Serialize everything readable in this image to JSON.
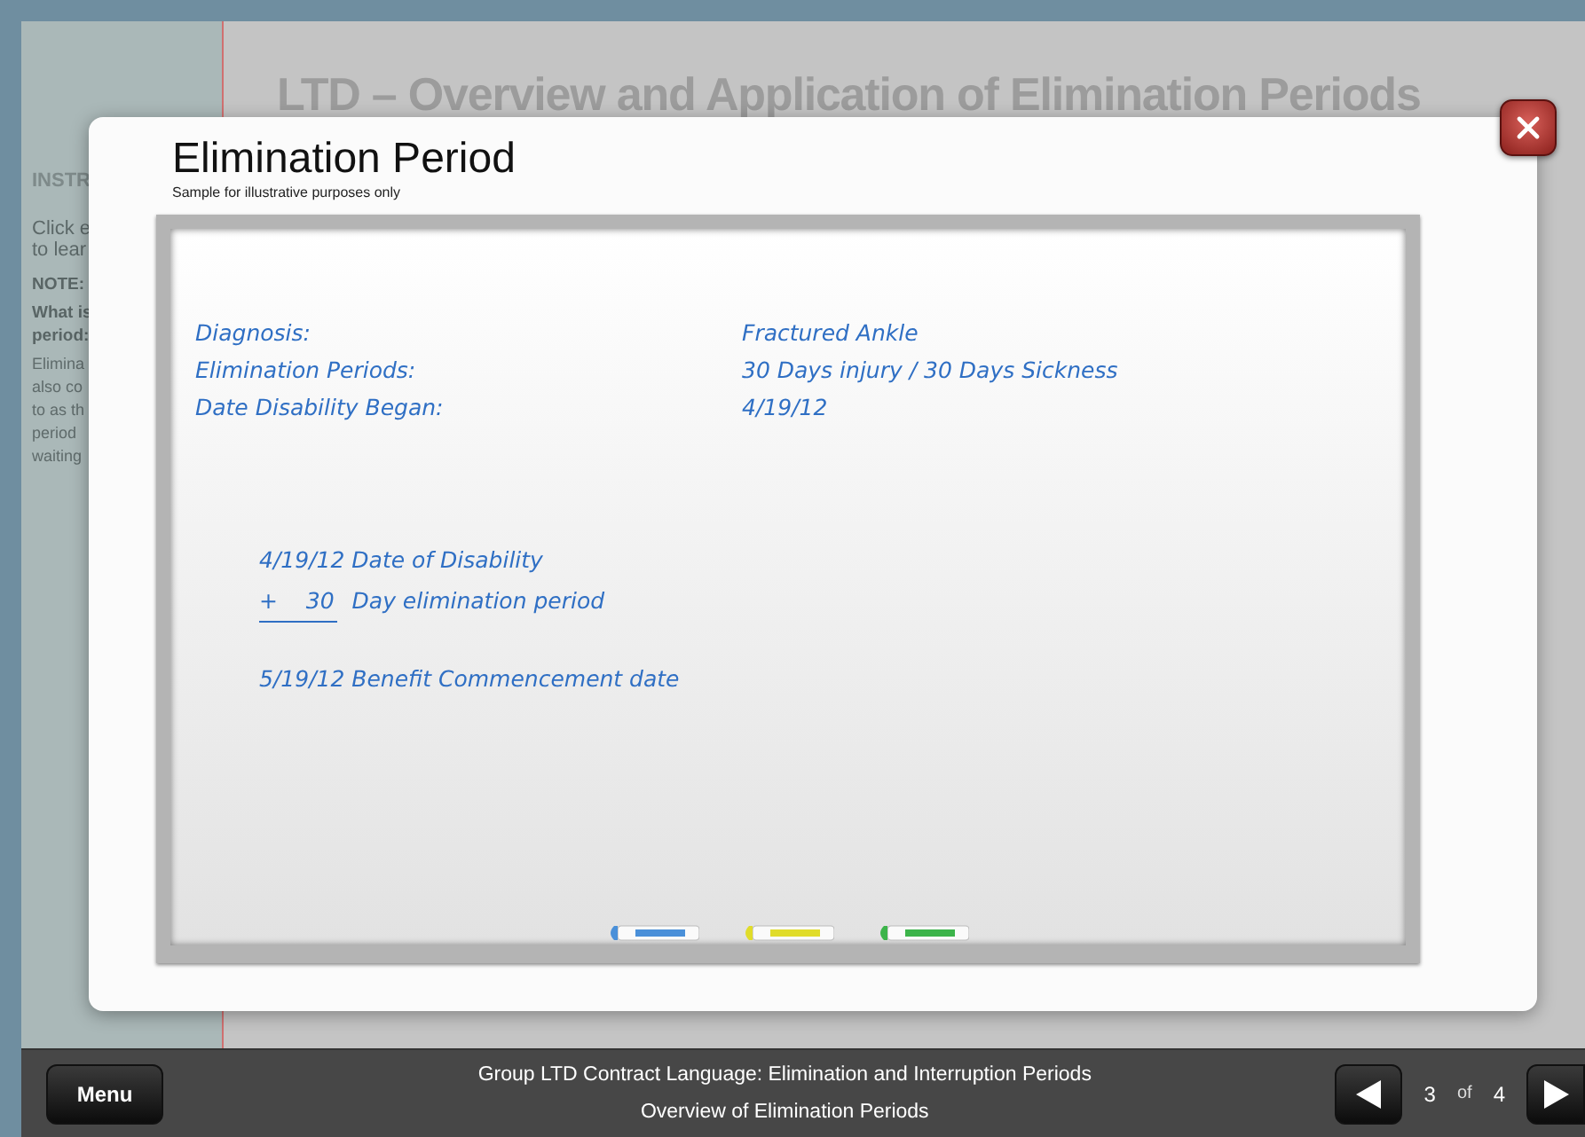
{
  "page_heading": "LTD – Overview and Application of Elimination Periods",
  "sidebar": {
    "heading": "INSTR",
    "instructions": [
      "Click e",
      "to lear"
    ],
    "note_label": "NOTE:",
    "note_question": [
      "What is",
      "period:"
    ],
    "note_text": [
      "Elimina",
      "also co",
      "to as th",
      "period",
      "waiting"
    ]
  },
  "modal": {
    "title": "Elimination Period",
    "subtitle": "Sample for illustrative purposes only",
    "facts": [
      {
        "label": "Diagnosis:",
        "value": "Fractured Ankle"
      },
      {
        "label": "Elimination Periods:",
        "value": "30 Days injury / 30 Days Sickness"
      },
      {
        "label": "Date Disability Began:",
        "value": "4/19/12"
      }
    ],
    "calculation": [
      {
        "kind": "plain",
        "text": "4/19/12 Date of Disability"
      },
      {
        "kind": "sum",
        "operand": "+    30",
        "text": "Day elimination period"
      },
      {
        "kind": "result",
        "text": "5/19/12 Benefit Commencement date"
      }
    ],
    "markers": [
      {
        "color": "#4a90d9"
      },
      {
        "color": "#e0dc2a"
      },
      {
        "color": "#3cb44a"
      }
    ]
  },
  "footer": {
    "menu": "Menu",
    "course_title": "Group LTD Contract Language: Elimination and Interruption Periods",
    "lesson_title": "Overview of Elimination Periods",
    "page": "3",
    "of": "of",
    "total": "4"
  }
}
